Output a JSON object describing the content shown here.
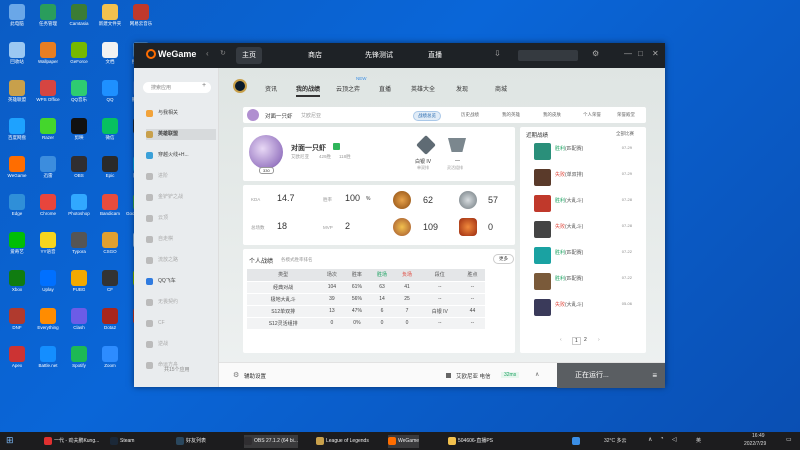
{
  "desktop": {
    "icons": [
      {
        "label": "此电脑",
        "color": "#6aa7e8"
      },
      {
        "label": "任务管理",
        "color": "#2a9d5c"
      },
      {
        "label": "Camtasia",
        "color": "#3b7c35"
      },
      {
        "label": "新建文件夹",
        "color": "#f2c14e"
      },
      {
        "label": "网易云音乐",
        "color": "#c0392b"
      },
      {
        "label": "回收站",
        "color": "#9bc8f2"
      },
      {
        "label": "Wallpaper",
        "color": "#e67e22"
      },
      {
        "label": "GeForce",
        "color": "#76b900"
      },
      {
        "label": "文档",
        "color": "#f2f2f2"
      },
      {
        "label": "控制面板",
        "color": "#4a90d9"
      },
      {
        "label": "英雄联盟",
        "color": "#c8a04b"
      },
      {
        "label": "WPS Office",
        "color": "#d64541"
      },
      {
        "label": "QQ音乐",
        "color": "#2ecc71"
      },
      {
        "label": "QQ",
        "color": "#1e90ff"
      },
      {
        "label": "腾讯会议",
        "color": "#2a6fd6"
      },
      {
        "label": "百度网盘",
        "color": "#1ea2ff"
      },
      {
        "label": "Razer",
        "color": "#44d62c"
      },
      {
        "label": "剪映",
        "color": "#111111"
      },
      {
        "label": "微信",
        "color": "#07c160"
      },
      {
        "label": "Steam",
        "color": "#1b2838"
      },
      {
        "label": "WeGame",
        "color": "#ff6d00"
      },
      {
        "label": "迅雷",
        "color": "#3c8dde"
      },
      {
        "label": "OBS",
        "color": "#302e31"
      },
      {
        "label": "Epic",
        "color": "#2a2a2a"
      },
      {
        "label": "网易UU",
        "color": "#00a0e9"
      },
      {
        "label": "Edge",
        "color": "#2f8fd8"
      },
      {
        "label": "Chrome",
        "color": "#e8453c"
      },
      {
        "label": "Photoshop",
        "color": "#31a8ff"
      },
      {
        "label": "Bandicam",
        "color": "#e74c3c"
      },
      {
        "label": "Google Chrome",
        "color": "#34a853"
      },
      {
        "label": "爱奇艺",
        "color": "#00be06"
      },
      {
        "label": "YY语音",
        "color": "#f7d51d"
      },
      {
        "label": "Typora",
        "color": "#555555"
      },
      {
        "label": "CSGO",
        "color": "#e0a030"
      },
      {
        "label": "原神",
        "color": "#8fb9e8"
      },
      {
        "label": "Xbox",
        "color": "#107c10"
      },
      {
        "label": "Uplay",
        "color": "#0070ff"
      },
      {
        "label": "PUBG",
        "color": "#f2a900"
      },
      {
        "label": "CF",
        "color": "#333333"
      },
      {
        "label": "Nvidia",
        "color": "#76b900"
      },
      {
        "label": "DNF",
        "color": "#b03a2e"
      },
      {
        "label": "Everything",
        "color": "#ff8c00"
      },
      {
        "label": "Clash",
        "color": "#6c5ce7"
      },
      {
        "label": "Dota2",
        "color": "#a8261c"
      },
      {
        "label": "Geek",
        "color": "#c0392b"
      },
      {
        "label": "Apex",
        "color": "#cc3333"
      },
      {
        "label": "Battle.net",
        "color": "#148eff"
      },
      {
        "label": "Spotify",
        "color": "#1db954"
      },
      {
        "label": "Zoom",
        "color": "#2d8cff"
      }
    ]
  },
  "wegame": {
    "logo": "WeGame",
    "nav": [
      "主页",
      "商店",
      "先锋测试",
      "直播"
    ],
    "sidebar": {
      "search_placeholder": "搜索应用",
      "items": [
        "与我相关",
        "英雄联盟",
        "穿越火线+H...",
        "进阶",
        "金铲铲之战",
        "云顶",
        "自走棋",
        "流放之路",
        "QQ飞车",
        "无畏契约",
        "CF",
        "逆战",
        "命运方舟"
      ],
      "footer": "共15个应用"
    },
    "game_nav": [
      "资讯",
      "我的战绩",
      "云顶之弈",
      "直播",
      "英雄大全",
      "发现",
      "商城"
    ],
    "new_badge": "NEW",
    "profile_bar": {
      "name": "对面一只虾",
      "subtitle": "艾欧尼亚",
      "tabs": [
        "战绩总览",
        "历史战绩",
        "我的英雄",
        "我的皮肤",
        "个人荣誉",
        "荣誉殿堂"
      ]
    },
    "profile": {
      "name": "对面一只虾",
      "server": "艾欧尼亚",
      "rank_label": "白银 IV",
      "rank_sub": "单双排",
      "flex_label": "—",
      "flex_sub": "灵活组排",
      "level": "330",
      "games": "429胜",
      "wins": "118胜"
    },
    "stats": {
      "kda_label": "KDA",
      "kda": "14.7",
      "winrate_label": "胜率",
      "winrate": "100",
      "winrate_unit": "%",
      "games_label": "总场数",
      "games": "18",
      "mvp_label": "MVP",
      "mvp": "2",
      "badge1": "62",
      "badge2": "57",
      "badge3": "109",
      "badge4": "0"
    },
    "record": {
      "title": "个人战绩",
      "sub": "各模式胜率排名",
      "more": "更多",
      "headers": [
        "类型",
        "场次",
        "胜率",
        "胜场",
        "负场",
        "段位",
        "胜点"
      ],
      "rows": [
        [
          "经典对战",
          "104",
          "61%",
          "63",
          "41",
          "--",
          "--"
        ],
        [
          "极地大乱斗",
          "39",
          "56%",
          "14",
          "25",
          "--",
          "--"
        ],
        [
          "S12单双排",
          "13",
          "47%",
          "6",
          "7",
          "白银 IV",
          "44"
        ],
        [
          "S12灵活组排",
          "0",
          "0%",
          "0",
          "0",
          "--",
          "--"
        ]
      ]
    },
    "recent": {
      "title": "近期战绩",
      "filter": "全部比赛",
      "matches": [
        {
          "result": "胜利",
          "mode": "(匹配赛)",
          "date": "07-29",
          "color": "#1aa260"
        },
        {
          "result": "失败",
          "mode": "(单双排)",
          "date": "07-29",
          "color": "#e04a3f"
        },
        {
          "result": "胜利",
          "mode": "(大乱斗)",
          "date": "07-28",
          "color": "#1aa260"
        },
        {
          "result": "失败",
          "mode": "(大乱斗)",
          "date": "07-28",
          "color": "#e04a3f"
        },
        {
          "result": "胜利",
          "mode": "(匹配赛)",
          "date": "07-22",
          "color": "#1aa260"
        },
        {
          "result": "胜利",
          "mode": "(匹配赛)",
          "date": "07-22",
          "color": "#1aa260"
        },
        {
          "result": "失败",
          "mode": "(大乱斗)",
          "date": "05-06",
          "color": "#e04a3f"
        }
      ],
      "pages": [
        "1",
        "2"
      ]
    },
    "bottom": {
      "settings": "辅助设置",
      "account": "艾欧尼亚 电信",
      "ping": "32ms",
      "running": "正在运行..."
    }
  },
  "taskbar": {
    "items": [
      {
        "label": "一代 - 劲夫鹏Kung...",
        "color": "#e03030"
      },
      {
        "label": "Steam",
        "color": "#1b2838"
      },
      {
        "label": "好友列表",
        "color": "#2a475e"
      },
      {
        "label": "OBS 27.1.2 (64 bi...",
        "color": "#302e31"
      },
      {
        "label": "League of Legends",
        "color": "#c8a04b"
      },
      {
        "label": "WeGame",
        "color": "#ff6d00"
      },
      {
        "label": "504606-直播PS",
        "color": "#f2c14e"
      }
    ],
    "weather": "32°C 多云",
    "lang": "英",
    "time": "16:49",
    "date": "2022/7/29"
  }
}
